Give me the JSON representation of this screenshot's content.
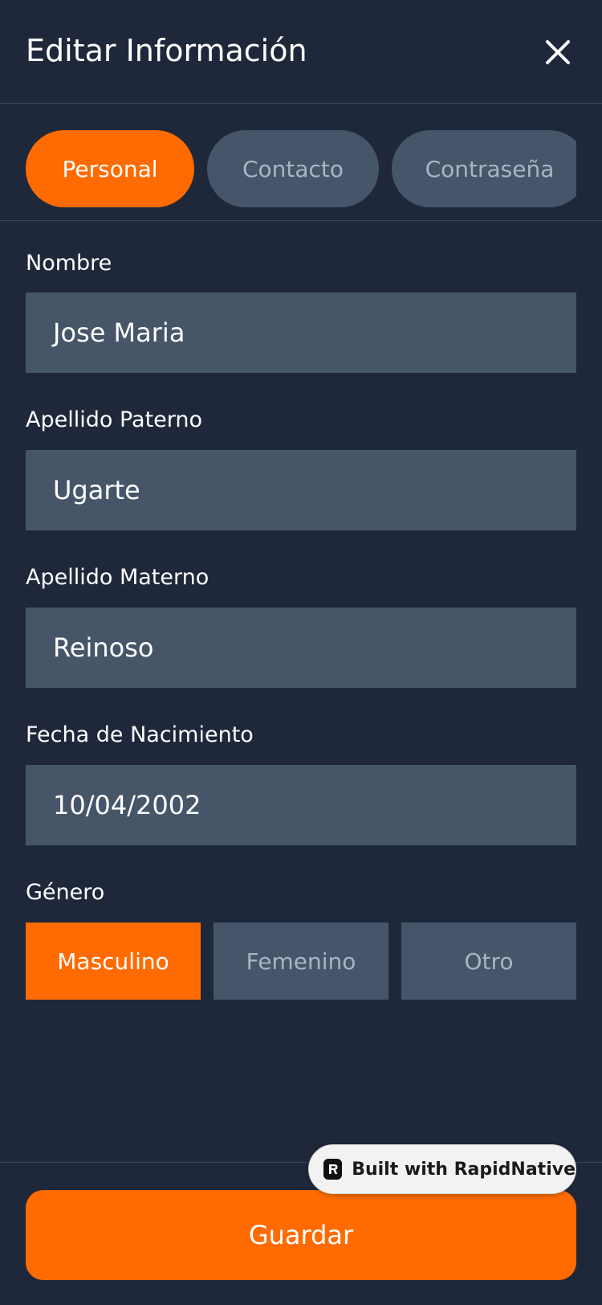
{
  "header": {
    "title": "Editar Información",
    "close_icon": "close-icon"
  },
  "tabs": [
    {
      "label": "Personal",
      "active": true
    },
    {
      "label": "Contacto",
      "active": false
    },
    {
      "label": "Contraseña",
      "active": false
    }
  ],
  "form": {
    "nombre": {
      "label": "Nombre",
      "value": "Jose Maria"
    },
    "apellido_paterno": {
      "label": "Apellido Paterno",
      "value": "Ugarte"
    },
    "apellido_materno": {
      "label": "Apellido Materno",
      "value": "Reinoso"
    },
    "fecha_nacimiento": {
      "label": "Fecha de Nacimiento",
      "value": "10/04/2002"
    },
    "genero": {
      "label": "Género",
      "options": [
        "Masculino",
        "Femenino",
        "Otro"
      ],
      "selected": "Masculino"
    }
  },
  "footer": {
    "save_label": "Guardar"
  },
  "badge": {
    "label": "Built with RapidNative",
    "icon": "rapidnative-logo-icon"
  },
  "colors": {
    "background": "#1f283a",
    "accent": "#ff6b00",
    "input_bg": "#475568",
    "inactive_text": "#a9b4c4"
  }
}
